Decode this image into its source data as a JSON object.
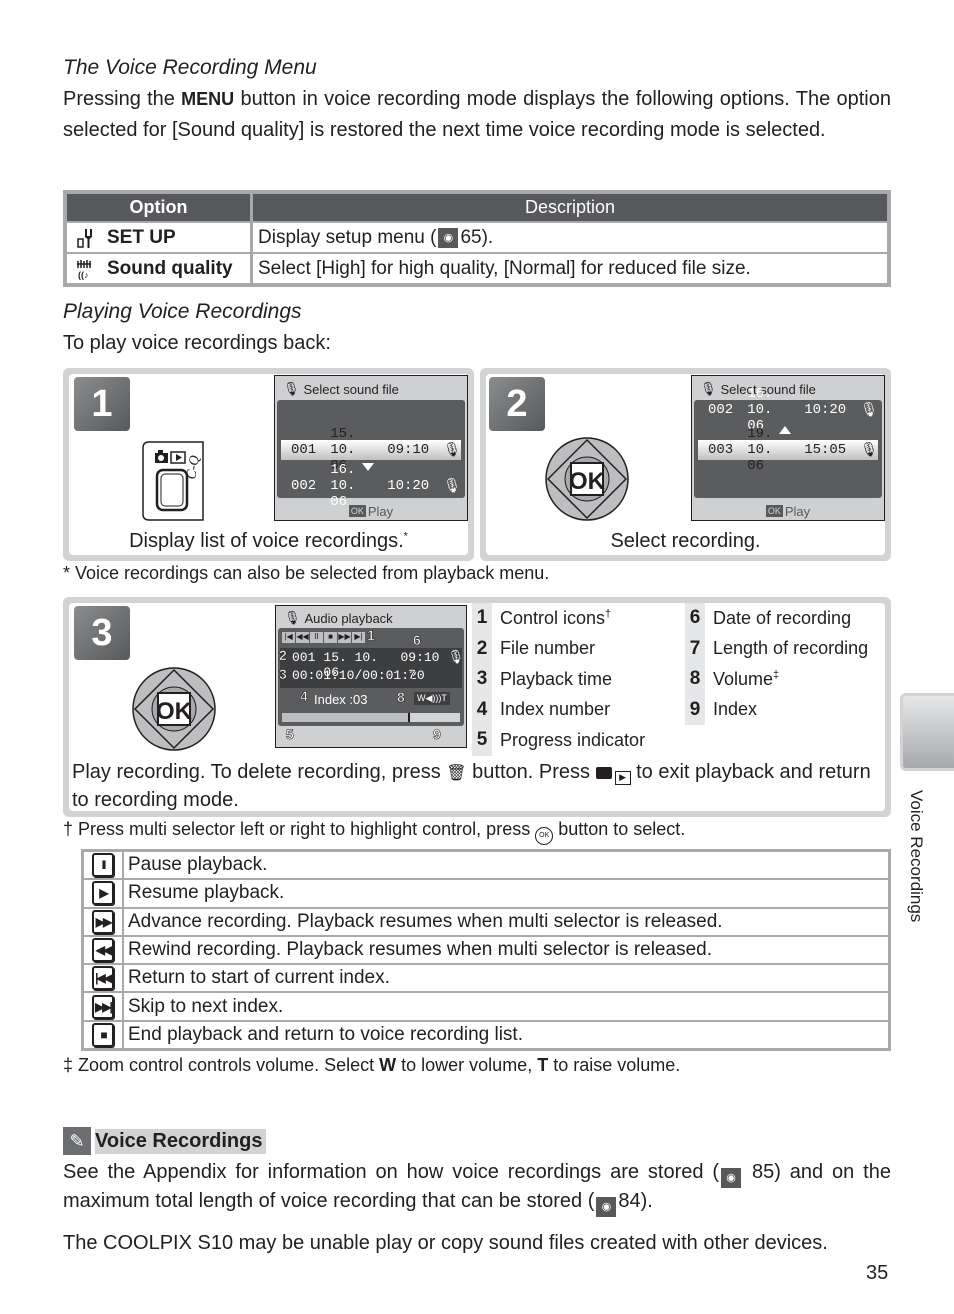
{
  "menu_section": {
    "heading": "The Voice Recording Menu",
    "intro_before": "Pressing the ",
    "menu_button": "MENU",
    "intro_after": " button in voice recording mode displays the following options. The option selected for [Sound quality] is restored the next time voice recording mode is selected.",
    "table": {
      "headers": [
        "Option",
        "Description"
      ],
      "rows": [
        {
          "icon": "setup-wrench-icon",
          "option": "SET UP",
          "description_before": "Display setup menu (",
          "ref_icon": "page-ref-icon",
          "description_after": " 65)."
        },
        {
          "icon": "sound-quality-icon",
          "option": "Sound quality",
          "description": "Select [High] for high quality, [Normal] for reduced file size."
        }
      ]
    }
  },
  "playing_section": {
    "heading": "Playing Voice Recordings",
    "intro": "To play voice recordings back:"
  },
  "steps": [
    {
      "number": "1",
      "caption": "Display list of voice recordings.",
      "caption_sup": "*",
      "screen": {
        "title": "Select sound file",
        "rows": [
          {
            "file": "001",
            "date": "15. 10. 06",
            "time": "09:10",
            "selected": true
          },
          {
            "file": "002",
            "date": "16. 10. 06",
            "time": "10:20",
            "selected": false
          }
        ],
        "arrow": "down",
        "footer": "Play",
        "ok_label": "OK"
      }
    },
    {
      "number": "2",
      "caption": "Select recording.",
      "screen": {
        "title": "Select sound file",
        "rows": [
          {
            "file": "002",
            "date": "16. 10. 06",
            "time": "10:20",
            "selected": false
          },
          {
            "file": "003",
            "date": "19. 10. 06",
            "time": "15:05",
            "selected": true
          }
        ],
        "arrow": "up",
        "footer": "Play",
        "ok_label": "OK"
      },
      "dpad_label": "OK"
    },
    {
      "number": "3",
      "dpad_label": "OK",
      "caption_parts": {
        "a": "Play recording.   To delete recording, press ",
        "b": " button.  Press ",
        "c": " to exit playback and return to recording mode."
      },
      "screen": {
        "title": "Audio playback",
        "file": "001",
        "date": "15. 10. 06",
        "time": "09:10",
        "playback_time": "00:01:10/00:01:20",
        "index_label": "Index :03",
        "callouts": [
          "1",
          "2",
          "3",
          "4",
          "5",
          "6",
          "7",
          "8",
          "9"
        ],
        "progress": 0.72
      },
      "legend": [
        {
          "num": "1",
          "label": "Control icons",
          "sup": "†"
        },
        {
          "num": "2",
          "label": "File number"
        },
        {
          "num": "3",
          "label": "Playback time"
        },
        {
          "num": "4",
          "label": "Index number"
        },
        {
          "num": "5",
          "label": "Progress indicator"
        },
        {
          "num": "6",
          "label": "Date of recording"
        },
        {
          "num": "7",
          "label": "Length of recording"
        },
        {
          "num": "8",
          "label": "Volume",
          "sup": "‡"
        },
        {
          "num": "9",
          "label": "Index"
        }
      ]
    }
  ],
  "footnote_star": "* Voice recordings can also be selected from playback menu.",
  "footnote_dagger_before": "† Press multi selector left or right to highlight control, press ",
  "footnote_dagger_after": " button to select.",
  "controls": [
    {
      "icon": "pause-icon",
      "glyph": "II",
      "text": "Pause playback."
    },
    {
      "icon": "play-icon",
      "glyph": "▶",
      "text": "Resume playback."
    },
    {
      "icon": "fast-forward-icon",
      "glyph": "▶▶",
      "text": "Advance recording.  Playback resumes when multi selector is released."
    },
    {
      "icon": "rewind-icon",
      "glyph": "◀◀",
      "text": "Rewind recording.  Playback resumes when multi selector is released."
    },
    {
      "icon": "skip-back-icon",
      "glyph": "|◀◀",
      "text": "Return to start of current index."
    },
    {
      "icon": "skip-forward-icon",
      "glyph": "▶▶|",
      "text": "Skip to next index."
    },
    {
      "icon": "stop-icon",
      "glyph": "■",
      "text": "End playback and return to voice recording list."
    }
  ],
  "footnote_ddagger": {
    "before": "‡ Zoom control controls volume.  Select ",
    "w": "W",
    "middle": " to lower volume, ",
    "t": "T",
    "after": " to raise volume."
  },
  "note": {
    "title": "Voice Recordings",
    "p1_a": "See the Appendix for information on how voice recordings are stored (",
    "p1_ref1": "85",
    "p1_b": ") and on the maximum total length of voice recording that can be stored (",
    "p1_ref2": "84",
    "p1_c": ").",
    "p2": "The COOLPIX S10 may be unable play or copy sound files created with other devices."
  },
  "side_tab_label": "Voice Recordings",
  "page_number": "35"
}
